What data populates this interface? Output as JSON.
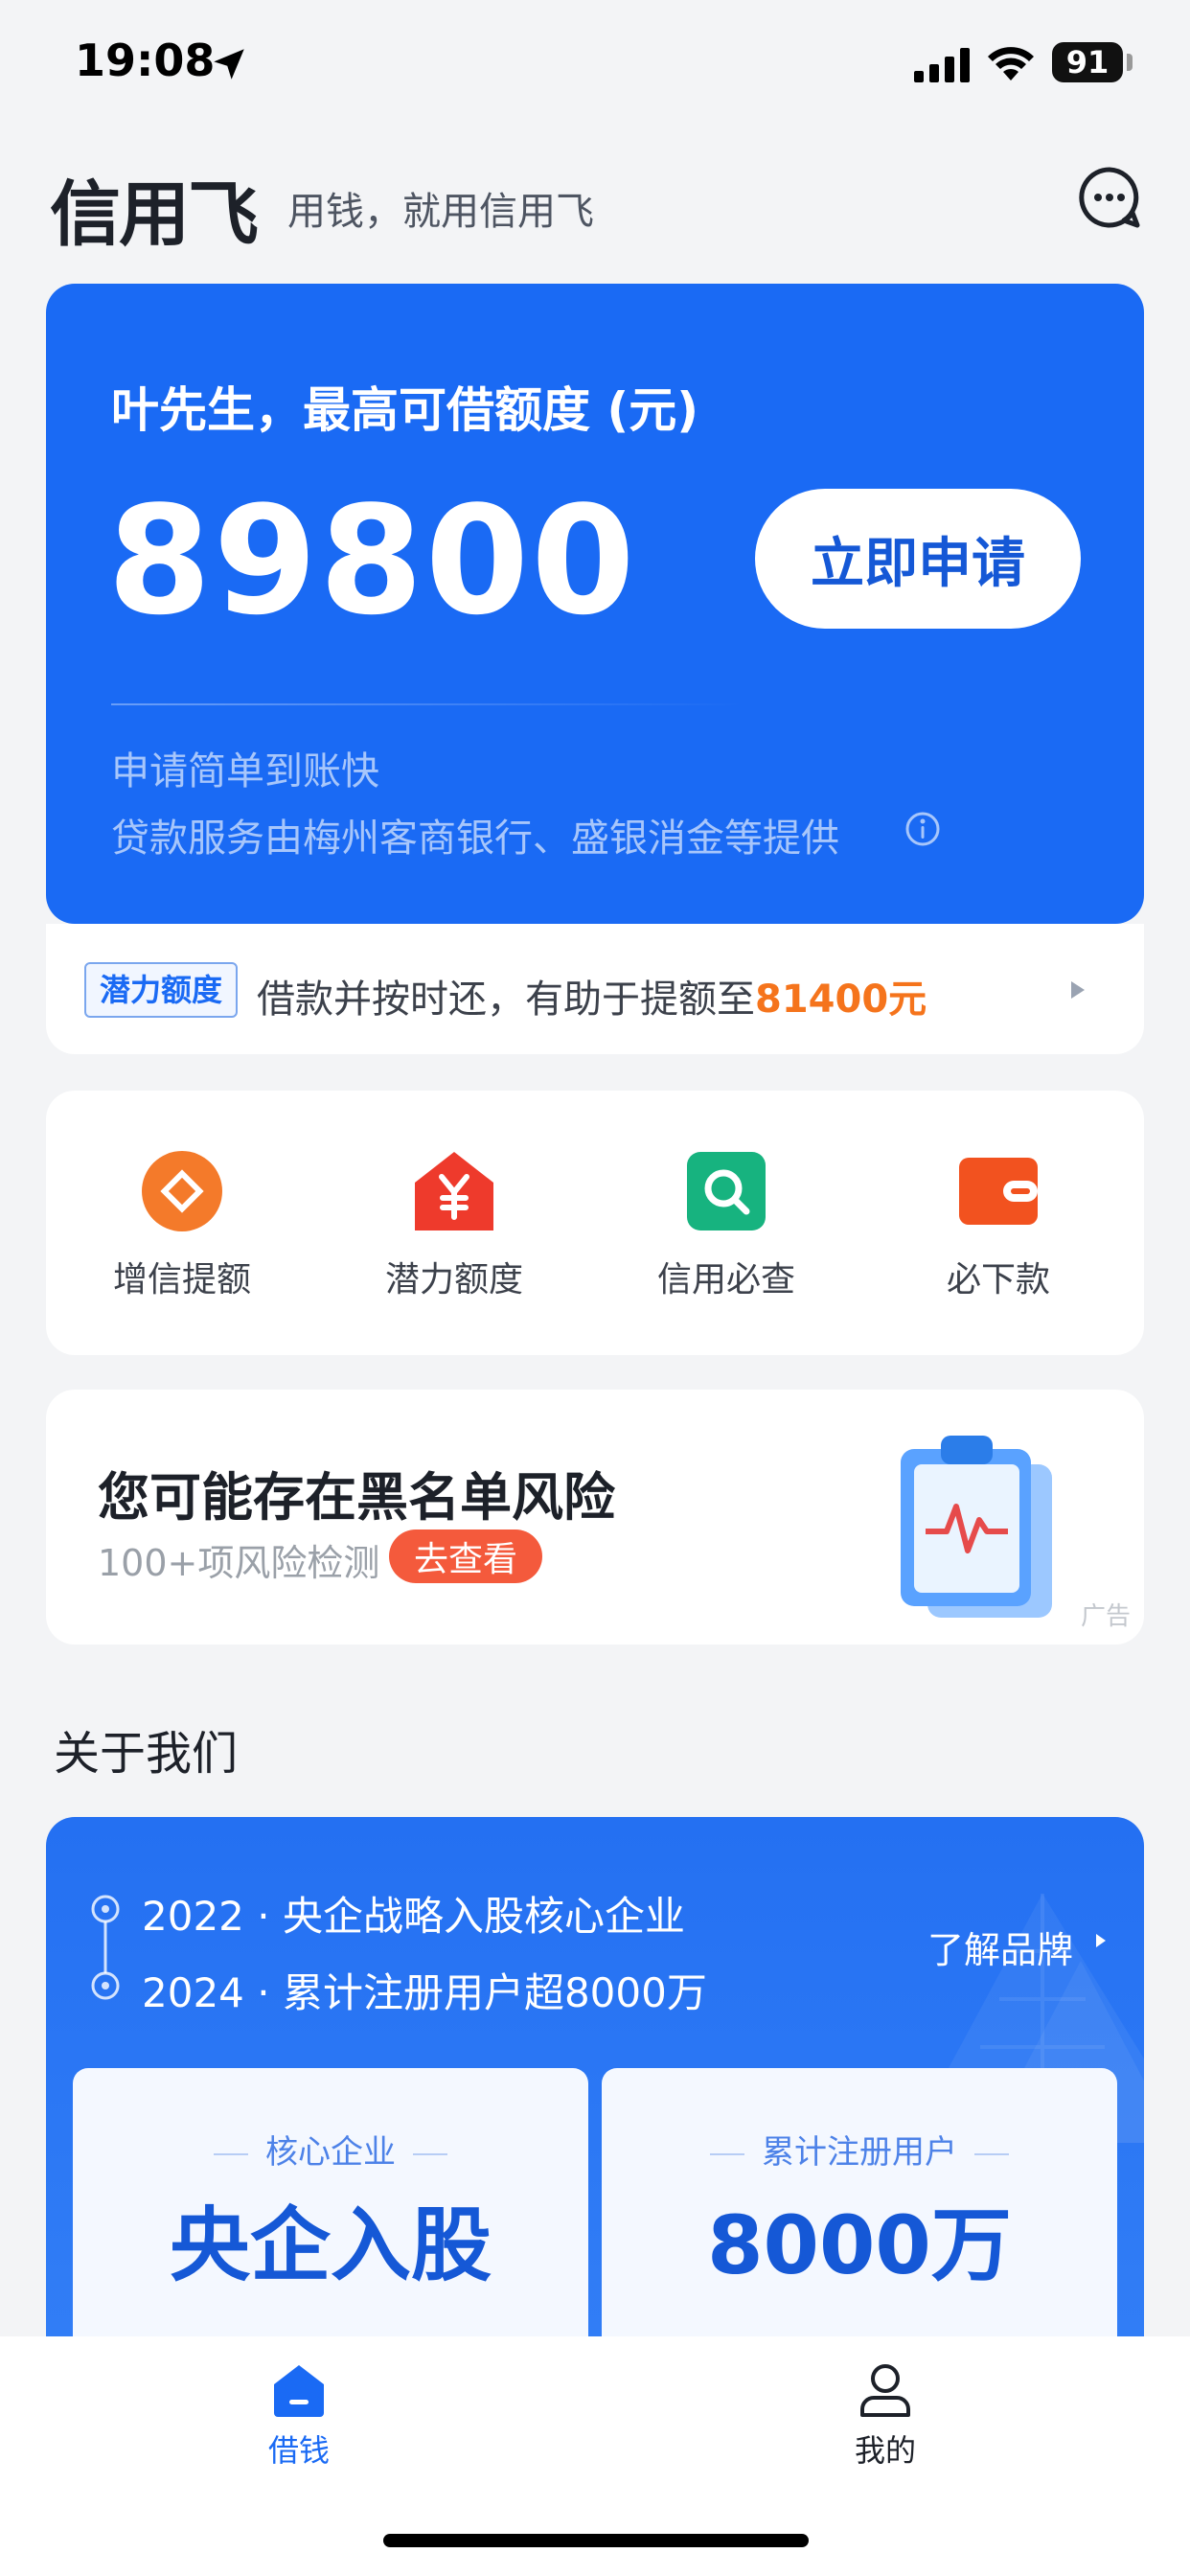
{
  "status_bar": {
    "time": "19:08",
    "battery": "91"
  },
  "header": {
    "title": "信用飞",
    "slogan": "用钱，就用信用飞",
    "chat_icon": "chat-bubble-icon"
  },
  "credit_card": {
    "label": "叶先生，最高可借额度 (元)",
    "amount": "89800",
    "apply_label": "立即申请",
    "sub1": "申请简单到账快",
    "sub2": "贷款服务由梅州客商银行、盛银消金等提供"
  },
  "potential": {
    "tag": "潜力额度",
    "text": "借款并按时还，有助于提额至",
    "amount": "81400元"
  },
  "shortcuts": [
    {
      "label": "增信提额",
      "icon": "diamond-coin-icon",
      "color": "#f47a2a"
    },
    {
      "label": "潜力额度",
      "icon": "yen-house-icon",
      "color": "#ee3a2c"
    },
    {
      "label": "信用必查",
      "icon": "search-icon",
      "color": "#17b37f"
    },
    {
      "label": "必下款",
      "icon": "wallet-icon",
      "color": "#f2521f"
    }
  ],
  "ad": {
    "title": "您可能存在黑名单风险",
    "sub": "100+项风险检测",
    "button": "去查看",
    "mark": "广告"
  },
  "about": {
    "title": "关于我们",
    "timeline": [
      {
        "year": "2022",
        "text": "央企战略入股核心企业"
      },
      {
        "year": "2024",
        "text": "累计注册用户超8000万"
      }
    ],
    "brand_link": "了解品牌",
    "stats": [
      {
        "label": "核心企业",
        "value": "央企入股"
      },
      {
        "label": "累计注册用户",
        "value": "8000万"
      }
    ]
  },
  "tabs": [
    {
      "label": "借钱",
      "active": true
    },
    {
      "label": "我的",
      "active": false
    }
  ],
  "colors": {
    "brand_blue": "#1a6af4",
    "accent_orange": "#f5741c",
    "ad_button": "#f45a3c"
  }
}
